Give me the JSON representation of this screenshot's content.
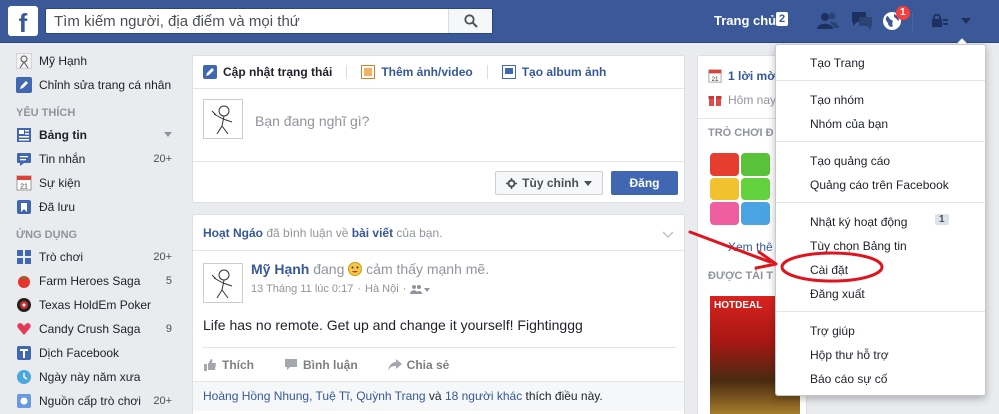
{
  "topbar": {
    "logo": "f",
    "search_placeholder": "Tìm kiếm người, địa điểm và mọi thứ",
    "home_label": "Trang chủ",
    "home_count": "2",
    "notifications_count": "1"
  },
  "sidebar": {
    "profile_name": "Mỹ Hạnh",
    "edit_profile": "Chỉnh sửa trang cá nhân",
    "favorites_heading": "YÊU THÍCH",
    "favorites": [
      {
        "label": "Bảng tin",
        "count": ""
      },
      {
        "label": "Tin nhắn",
        "count": "20+"
      },
      {
        "label": "Sự kiện",
        "count": ""
      },
      {
        "label": "Đã lưu",
        "count": ""
      }
    ],
    "apps_heading": "ỨNG DỤNG",
    "apps": [
      {
        "label": "Trò chơi",
        "count": "20+"
      },
      {
        "label": "Farm Heroes Saga",
        "count": "5"
      },
      {
        "label": "Texas HoldEm Poker",
        "count": ""
      },
      {
        "label": "Candy Crush Saga",
        "count": "9"
      },
      {
        "label": "Dịch Facebook",
        "count": ""
      },
      {
        "label": "Ngày này năm xưa",
        "count": ""
      },
      {
        "label": "Nguồn cấp trò chơi",
        "count": "20+"
      }
    ]
  },
  "composer": {
    "tab_status": "Cập nhật trạng thái",
    "tab_photo": "Thêm ảnh/video",
    "tab_album": "Tạo album ảnh",
    "placeholder": "Bạn đang nghĩ gì?",
    "custom_label": "Tùy chỉnh",
    "post_label": "Đăng"
  },
  "post": {
    "story_actor": "Hoạt Ngáo",
    "story_mid": " đã bình luận về ",
    "story_object": "bài viết",
    "story_end": " của bạn.",
    "author": "Mỹ Hạnh",
    "feeling_pre": " đang ",
    "feeling_text": " cảm thấy mạnh mẽ.",
    "date": "13 Tháng 11 lúc 0:17",
    "separator": "·",
    "location": "Hà Nội",
    "text": "Life has no remote. Get up and change it yourself! Fightinggg",
    "like": "Thích",
    "comment": "Bình luận",
    "share": "Chia sẻ",
    "likers": "Hoàng Hồng Nhung, Tuệ Tĩ, Quỳnh Trang",
    "likers_and": " và ",
    "likers_others": "18 người khác",
    "likers_end": " thích điều này."
  },
  "right": {
    "events": "1 lời mờ",
    "today": "Hôm nay",
    "games_heading": "TRÒ CHƠI Đ",
    "more_label": "Xem thê",
    "sponsored_heading": "ĐƯỢC TÀI T",
    "ad_label": "HOTDEAL"
  },
  "menu": {
    "items": [
      "Tạo Trang",
      "Tạo nhóm",
      "Nhóm của bạn",
      "Tạo quảng cáo",
      "Quảng cáo trên Facebook",
      "Nhật ký hoạt động",
      "Tùy chọn Bảng tin",
      "Cài đặt",
      "Đăng xuất",
      "Trợ giúp",
      "Hộp thư hỗ trợ",
      "Báo cáo sự cố"
    ],
    "activity_badge": "1"
  },
  "colors": {
    "brand": "#3b5998",
    "link": "#365899",
    "annotation": "#e0141e"
  }
}
